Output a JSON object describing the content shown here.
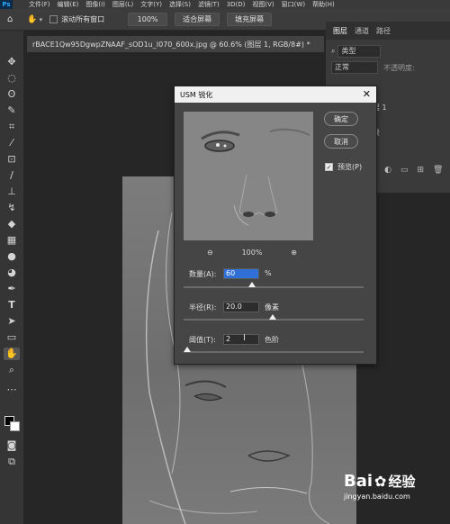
{
  "menubar": {
    "logo": "Ps",
    "items": [
      "文件(F)",
      "编辑(E)",
      "图像(I)",
      "图层(L)",
      "文字(Y)",
      "选择(S)",
      "滤镜(T)",
      "3D(D)",
      "视图(V)",
      "窗口(W)",
      "帮助(H)"
    ]
  },
  "options": {
    "scroll_all_label": "滚动所有窗口",
    "zoom_value": "100%",
    "fit_screen_label": "适合屏幕",
    "fill_screen_label": "填充屏幕"
  },
  "document": {
    "tab_title": "rBACE1Qw95DgwpZNAAF_sOD1u_I070_600x.jpg @ 60.6% (图层 1, RGB/8#) *"
  },
  "panel": {
    "tabs": [
      "图层",
      "通道",
      "路径"
    ],
    "kind_label": "类型",
    "mode_label": "正常",
    "opacity_label": "不透明度:",
    "layer_name": "层 1",
    "layer_name2": "景"
  },
  "dialog": {
    "title": "USM 锐化",
    "ok_label": "确定",
    "cancel_label": "取消",
    "preview_label": "预览(P)",
    "preview_checked": true,
    "zoom_value": "100%",
    "amount_label": "数量(A):",
    "amount_value": "60",
    "amount_unit": "%",
    "amount_level": 0.3,
    "radius_label": "半径(R):",
    "radius_value": "20.0",
    "radius_unit": "像素",
    "radius_level": 0.42,
    "threshold_label": "阈值(T):",
    "threshold_value": "2",
    "threshold_unit": "色阶",
    "threshold_level": 0.01
  },
  "watermark": {
    "brand": "Bai",
    "brand2": "经验",
    "url": "jingyan.baidu.com"
  },
  "colors": {
    "selection_blue": "#2f6fd6",
    "dialog_bg": "#454545"
  }
}
